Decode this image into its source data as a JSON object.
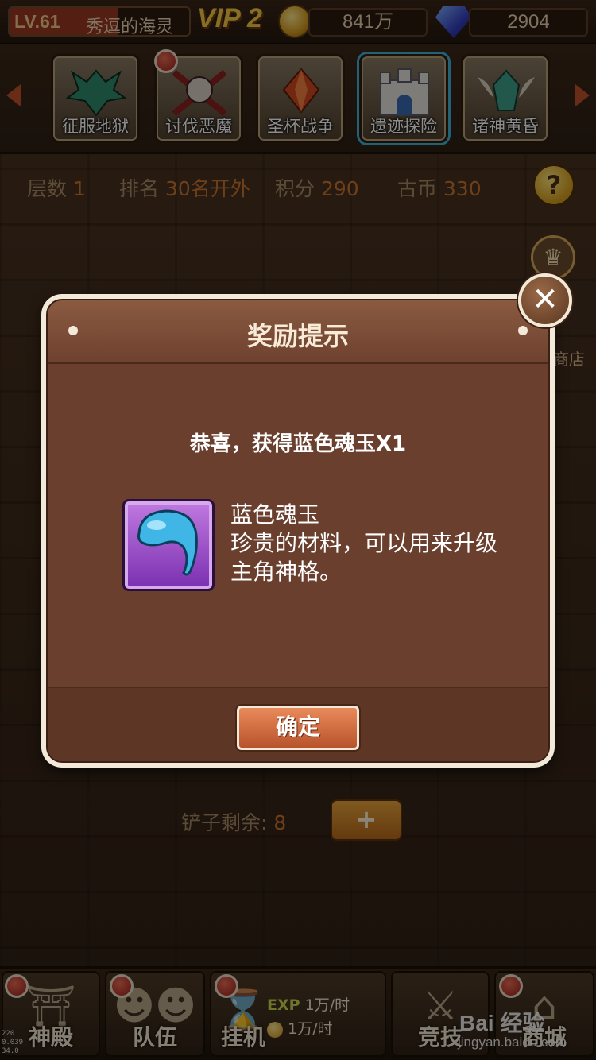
{
  "player": {
    "level": "LV.61",
    "name": "秀逗的海灵",
    "exp_fraction": 0.6
  },
  "vip": "VIP 2",
  "currency": {
    "gold": "841万",
    "gems": "2904"
  },
  "modes": [
    {
      "label": "征服地狱",
      "active": false,
      "has_alert": false
    },
    {
      "label": "讨伐恶魔",
      "active": false,
      "has_alert": true
    },
    {
      "label": "圣杯战争",
      "active": false,
      "has_alert": false
    },
    {
      "label": "遗迹探险",
      "active": true,
      "has_alert": false
    },
    {
      "label": "诸神黄昏",
      "active": false,
      "has_alert": false
    }
  ],
  "stats": {
    "floor_label": "层数",
    "floor_value": "1",
    "rank_label": "排名",
    "rank_value": "30名开外",
    "score_label": "积分",
    "score_value": "290",
    "coin_label": "古币",
    "coin_value": "330"
  },
  "help_icon": "?",
  "side": {
    "shop_label": "商店"
  },
  "shovel": {
    "label": "铲子剩余:",
    "value": "8",
    "plus_label": "+"
  },
  "dialog": {
    "title": "奖励提示",
    "message": "恭喜，获得蓝色魂玉X1",
    "item_name": "蓝色魂玉",
    "item_desc": "珍贵的材料，可以用来升级主角神格。",
    "confirm_label": "确定",
    "close_label": "✕"
  },
  "nav": [
    {
      "label": "神殿",
      "has_alert": true
    },
    {
      "label": "队伍",
      "has_alert": true
    },
    {
      "label": "挂机",
      "has_alert": true
    },
    {
      "label": "竞技",
      "has_alert": false
    },
    {
      "label": "商城",
      "has_alert": true
    }
  ],
  "afk": {
    "exp_label": "EXP",
    "exp_rate": "1万/时",
    "gold_rate": "1万/时"
  },
  "debug_lines": [
    "220",
    "0.039",
    "34.0"
  ],
  "watermark": {
    "logo": "Bai 经验",
    "url": "jingyan.baidu.com"
  },
  "colors": {
    "accent": "#c9762e",
    "active_tab_glow": "#3fb3d9",
    "dialog_bg": "#6a3f2e"
  }
}
